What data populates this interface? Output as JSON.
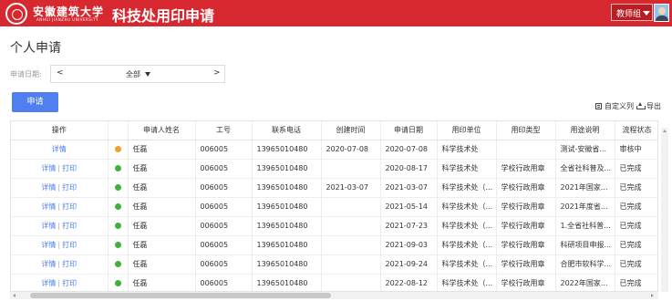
{
  "header": {
    "university_name": "安徽建筑大学",
    "university_name_en": "ANHUI JIANZHU UNIVERSITY",
    "app_title": "科技处用印申请",
    "user_name": "教师组",
    "brand_color": "#d7282f"
  },
  "page": {
    "title": "个人申请"
  },
  "filter": {
    "label": "申请日期:",
    "prev": "<",
    "value": "全部",
    "next": ">"
  },
  "toolbar": {
    "apply_label": "申请",
    "custom_columns_label": "自定义列",
    "export_label": "导出"
  },
  "table": {
    "columns": [
      "操作",
      "申请人姓名",
      "工号",
      "联系电话",
      "创建时间",
      "申请日期",
      "用印单位",
      "用印类型",
      "用途说明",
      "流程状态"
    ],
    "rows": [
      {
        "ops": [
          "详情"
        ],
        "status_color": "#f0a030",
        "name": "任磊",
        "id": "006005",
        "phone": "13965010480",
        "created": "2020-07-08",
        "date": "2020-07-08",
        "unit": "科学技术处",
        "type": "",
        "purpose": "测试-安徽省...",
        "status": "审核中"
      },
      {
        "ops": [
          "详情",
          "打印"
        ],
        "status_color": "#3fb23a",
        "name": "任磊",
        "id": "006005",
        "phone": "13965010480",
        "created": "",
        "date": "2020-08-17",
        "unit": "科学技术处",
        "type": "学校行政用章",
        "purpose": "全省社科普及...",
        "status": "已完成"
      },
      {
        "ops": [
          "详情",
          "打印"
        ],
        "status_color": "#3fb23a",
        "name": "任磊",
        "id": "006005",
        "phone": "13965010480",
        "created": "2021-03-07",
        "date": "2021-03-07",
        "unit": "科学技术处（...",
        "type": "学校行政用章",
        "purpose": "2021年国家...",
        "status": "已完成"
      },
      {
        "ops": [
          "详情",
          "打印"
        ],
        "status_color": "#3fb23a",
        "name": "任磊",
        "id": "006005",
        "phone": "13965010480",
        "created": "",
        "date": "2021-05-14",
        "unit": "科学技术处（...",
        "type": "学校行政用章",
        "purpose": "2021年度省...",
        "status": "已完成"
      },
      {
        "ops": [
          "详情",
          "打印"
        ],
        "status_color": "#3fb23a",
        "name": "任磊",
        "id": "006005",
        "phone": "13965010480",
        "created": "",
        "date": "2021-07-23",
        "unit": "科学技术处（...",
        "type": "学校行政用章",
        "purpose": "1.全省社科普...",
        "status": "已完成"
      },
      {
        "ops": [
          "详情",
          "打印"
        ],
        "status_color": "#3fb23a",
        "name": "任磊",
        "id": "006005",
        "phone": "13965010480",
        "created": "",
        "date": "2021-09-03",
        "unit": "科学技术处（...",
        "type": "学校行政用章",
        "purpose": "科研项目申报...",
        "status": "已完成"
      },
      {
        "ops": [
          "详情",
          "打印"
        ],
        "status_color": "#3fb23a",
        "name": "任磊",
        "id": "006005",
        "phone": "13965010480",
        "created": "",
        "date": "2021-09-24",
        "unit": "科学技术处（...",
        "type": "学校行政用章",
        "purpose": "合肥市软科学...",
        "status": "已完成"
      },
      {
        "ops": [
          "详情",
          "打印"
        ],
        "status_color": "#3fb23a",
        "name": "任磊",
        "id": "006005",
        "phone": "13965010480",
        "created": "",
        "date": "2022-08-12",
        "unit": "科学技术处（...",
        "type": "学校行政用章",
        "purpose": "2022年国家...",
        "status": "已完成"
      }
    ]
  }
}
